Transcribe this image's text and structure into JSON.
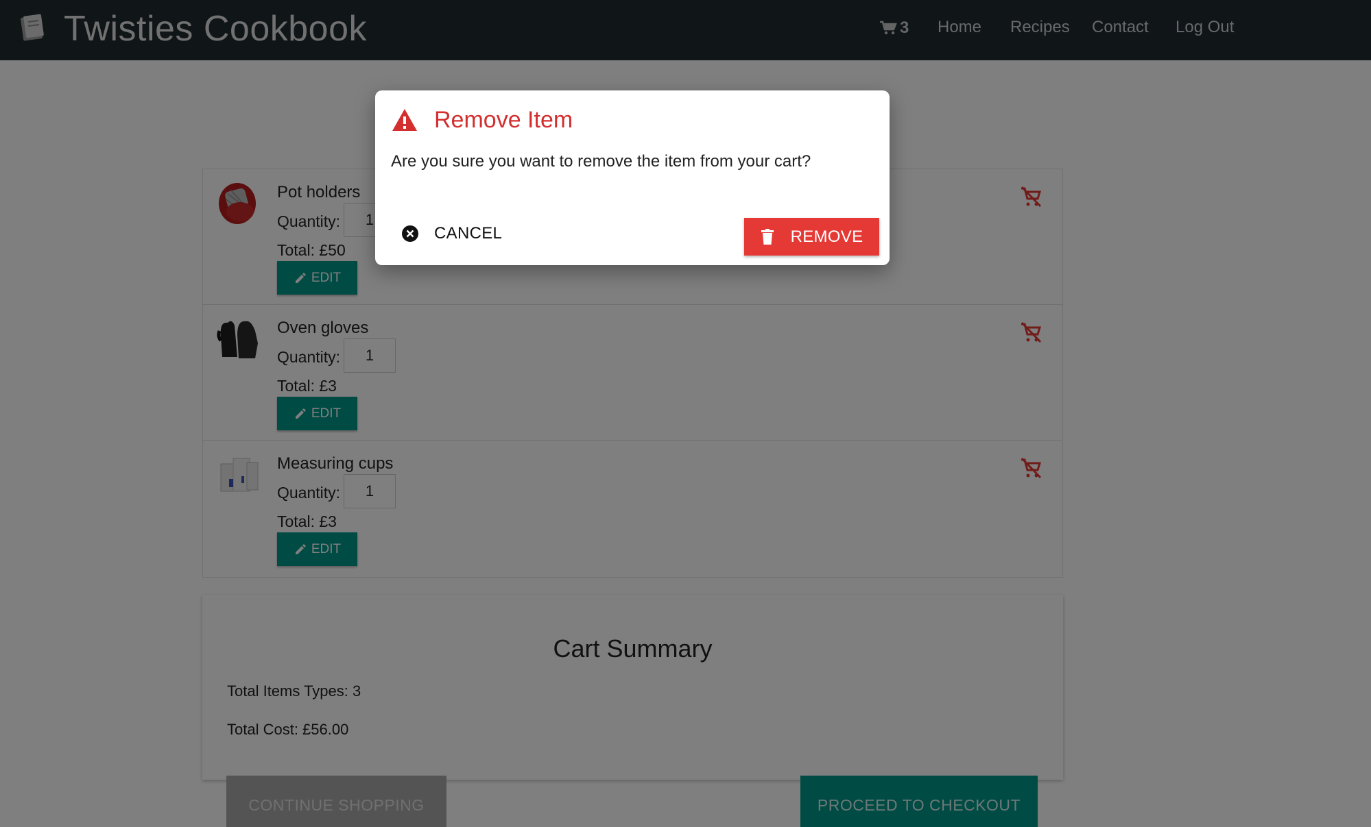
{
  "navbar": {
    "brand_title": "Twisties Cookbook",
    "cart_count": "3",
    "links": [
      "Home",
      "Recipes",
      "Contact",
      "Log Out"
    ]
  },
  "cart": {
    "items": [
      {
        "name": "Pot holders",
        "quantity_label": "Quantity:",
        "quantity": "1",
        "total": "Total: £50",
        "edit_label": "EDIT"
      },
      {
        "name": "Oven gloves",
        "quantity_label": "Quantity:",
        "quantity": "1",
        "total": "Total: £3",
        "edit_label": "EDIT"
      },
      {
        "name": "Measuring cups",
        "quantity_label": "Quantity:",
        "quantity": "1",
        "total": "Total: £3",
        "edit_label": "EDIT"
      }
    ]
  },
  "summary": {
    "title": "Cart Summary",
    "total_item_types": "Total Items Types: 3",
    "total_cost": "Total Cost: £56.00",
    "continue_label": "CONTINUE SHOPPING",
    "checkout_label": "PROCEED TO CHECKOUT"
  },
  "modal": {
    "title": "Remove Item",
    "message": "Are you sure you want to remove the item from your cart?",
    "cancel_label": "CANCEL",
    "remove_label": "REMOVE"
  },
  "colors": {
    "navbar": "#212a31",
    "teal": "#009688",
    "danger": "#e53935",
    "title_red": "#d32f2f"
  }
}
